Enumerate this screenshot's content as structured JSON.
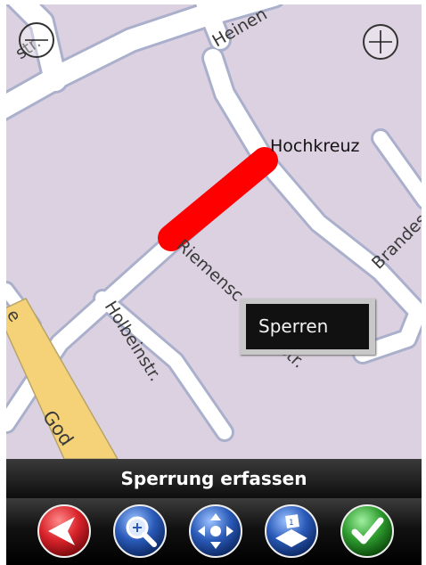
{
  "map": {
    "place_label": "Hochkreuz",
    "streets": {
      "heinen": "Heinen",
      "str_top_left": "str.",
      "brandes": "Brandes",
      "riemens": "Riemensc",
      "riemens_end": "rstr.",
      "holbein": "Holbeinstr.",
      "god": "God",
      "left_e": "e"
    },
    "blocked_segment_color": "#ff0000",
    "road_color": "#ffffff",
    "road_border_color": "#aab0cc",
    "main_road_color": "#f5d277",
    "background_color": "#dcd1e0"
  },
  "zoom_controls": {
    "zoom_out_icon": "minus-circle-icon",
    "zoom_in_icon": "plus-circle-icon"
  },
  "popup": {
    "label": "Sperren"
  },
  "titlebar": {
    "title": "Sperrung erfassen"
  },
  "toolbar": {
    "buttons": [
      {
        "icon": "back-arrow-icon",
        "color": "#d8232a"
      },
      {
        "icon": "zoom-magnifier-icon",
        "color": "#2a5ab8"
      },
      {
        "icon": "pan-arrows-icon",
        "color": "#2a5ab8"
      },
      {
        "icon": "map-options-icon",
        "color": "#2a5ab8"
      },
      {
        "icon": "confirm-check-icon",
        "color": "#2e9b2e"
      }
    ]
  }
}
